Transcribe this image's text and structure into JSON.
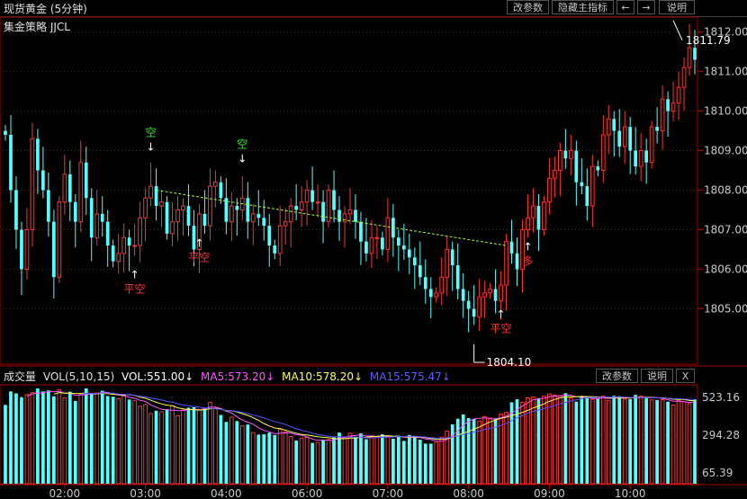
{
  "header": {
    "title": "现货黄金 (5分钟)",
    "buttons": [
      "改参数",
      "隐藏主指标",
      "←",
      "→",
      "说明"
    ]
  },
  "strategy_label": "集金策略 JJCL",
  "volume_header": {
    "name": "成交量",
    "vol_params": "VOL(5,10,15)",
    "vol_value": "VOL:551.00↓",
    "ma5": "MA5:573.20↓",
    "ma10": "MA10:578.20↓",
    "ma15": "MA15:575.47↓",
    "buttons": [
      "改参数",
      "说明",
      "X"
    ]
  },
  "colors": {
    "up": "#ff3232",
    "down": "#54ffff",
    "ma5": "#ff55ff",
    "ma10": "#ffff55",
    "ma15": "#5555ff",
    "signal_green": "#39e639",
    "signal_red": "#ff3232",
    "trend_line": "#a0ff40",
    "grid": "#a00000"
  },
  "chart_data": {
    "type": "candlestick",
    "interval": "5分钟",
    "price_axis": {
      "ticks": [
        "1805.00",
        "1806.00",
        "1807.00",
        "1808.00",
        "1809.00",
        "1810.00",
        "1811.00",
        "1812.00"
      ],
      "range": [
        1803.6,
        1812.4
      ]
    },
    "volume_axis": {
      "ticks": [
        "65.39",
        "294.28",
        "523.16"
      ],
      "range": [
        0,
        600
      ]
    },
    "time_axis": {
      "ticks": [
        "02:00",
        "03:00",
        "04:00",
        "06:00",
        "07:00",
        "08:00",
        "09:00",
        "10:00"
      ],
      "tick_bar_index": [
        11,
        26,
        41,
        56,
        71,
        86,
        101,
        116
      ]
    },
    "annotations": {
      "high_label": "1811.79",
      "high_value": 1811.79,
      "high_bar": 125,
      "low_label": "1804.10",
      "low_value": 1804.1,
      "low_bar": 87,
      "signals": [
        {
          "text": "空",
          "type": "short",
          "bar": 27
        },
        {
          "text": "平空",
          "type": "cover",
          "bar": 24
        },
        {
          "text": "平空",
          "type": "cover",
          "bar": 36
        },
        {
          "text": "空",
          "type": "short",
          "bar": 44
        },
        {
          "text": "平空",
          "type": "cover",
          "bar": 92
        },
        {
          "text": "多",
          "type": "long",
          "bar": 97
        }
      ],
      "trend_lines": [
        {
          "bar1": 28,
          "price1": 1808.0,
          "bar2": 93,
          "price2": 1806.6
        }
      ]
    },
    "series": [
      {
        "key": "anchor",
        "values": [
          1809.4,
          1808.0,
          1807.0,
          1806.0,
          1807.0,
          1809.3,
          1808.5,
          1808.0,
          1807.2,
          1805.8,
          1807.7,
          1808.4,
          1807.7,
          1807.2,
          1808.7,
          1807.8,
          1806.8,
          1807.4,
          1807.2,
          1806.6,
          1806.2,
          1806.4,
          1806.8,
          1806.6,
          1806.6,
          1807.3,
          1807.8,
          1808.1,
          1807.6,
          1807.7,
          1806.9,
          1807.2,
          1807.5,
          1807.6,
          1807.1,
          1806.5,
          1807.4,
          1807.1,
          1808.1,
          1808.2,
          1807.8,
          1807.2,
          1807.6,
          1807.5,
          1807.8,
          1807.2,
          1807.4,
          1807.3,
          1807.1,
          1806.6,
          1806.4,
          1807.1,
          1807.2,
          1807.6,
          1807.5,
          1807.7,
          1808.0,
          1807.7,
          1807.7,
          1807.2,
          1808.0,
          1807.5,
          1807.2,
          1807.4,
          1807.5,
          1807.2,
          1806.7,
          1806.4,
          1806.8,
          1806.8,
          1806.5,
          1807.3,
          1806.8,
          1806.6,
          1806.5,
          1806.3,
          1806.1,
          1805.8,
          1805.5,
          1805.3,
          1805.4,
          1805.8,
          1806.5,
          1806.1,
          1805.5,
          1805.2,
          1805.0,
          1804.8,
          1805.3,
          1805.4,
          1805.5,
          1805.2,
          1805.6,
          1806.7,
          1806.4,
          1806.0,
          1807.0,
          1807.3,
          1807.6,
          1807.0,
          1807.7,
          1808.3,
          1808.5,
          1809.0,
          1808.8,
          1809.0,
          1808.2,
          1808.1,
          1807.6,
          1808.6,
          1808.5,
          1809.4,
          1809.8,
          1809.5,
          1809.1,
          1809.6,
          1809.0,
          1808.6,
          1809.0,
          1808.7,
          1809.6,
          1809.5,
          1810.3,
          1810.0,
          1810.2,
          1810.6,
          1811.1,
          1811.6,
          1811.3
        ]
      },
      {
        "key": "volume",
        "values": [
          478,
          560,
          548,
          525,
          541,
          553,
          578,
          560,
          566,
          530,
          570,
          521,
          558,
          502,
          542,
          578,
          547,
          551,
          564,
          532,
          528,
          515,
          533,
          511,
          503,
          470,
          480,
          426,
          443,
          437,
          452,
          472,
          412,
          447,
          461,
          464,
          451,
          457,
          493,
          458,
          417,
          375,
          404,
          380,
          351,
          359,
          310,
          298,
          300,
          310,
          295,
          330,
          315,
          287,
          262,
          277,
          281,
          248,
          250,
          268,
          268,
          282,
          310,
          279,
          306,
          284,
          306,
          270,
          284,
          285,
          300,
          290,
          273,
          290,
          260,
          296,
          289,
          267,
          243,
          243,
          251,
          282,
          319,
          360,
          394,
          420,
          398,
          393,
          380,
          406,
          398,
          393,
          422,
          433,
          494,
          512,
          494,
          521,
          526,
          519,
          531,
          545,
          537,
          533,
          549,
          521,
          498,
          533,
          519,
          512,
          517,
          532,
          504,
          533,
          531,
          512,
          513,
          539,
          532,
          526,
          509,
          508,
          510,
          498,
          478,
          506,
          498,
          486,
          511,
          460
        ]
      }
    ]
  }
}
